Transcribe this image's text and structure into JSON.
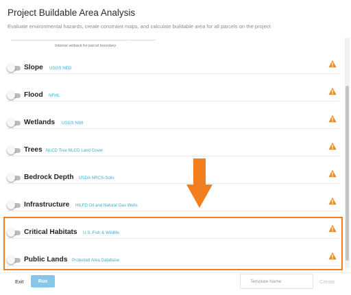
{
  "header": {
    "title": "Project Buildable Area Analysis",
    "subtitle": "Evaluate environmental hazards, create constraint maps, and calculate buildable area for all parcels on the project"
  },
  "setback": {
    "note": "Internal setback for parcel boundary"
  },
  "layers": [
    {
      "label": "Slope",
      "sources": "USGS NED",
      "enabled": false,
      "warning": true
    },
    {
      "label": "Flood",
      "sources": "NFHL",
      "enabled": false,
      "warning": true
    },
    {
      "label": "Wetlands",
      "sources": "USGS NWI",
      "enabled": false,
      "warning": true
    },
    {
      "label": "Trees",
      "sources": "NLCD Tree  NLCD Land Cover",
      "enabled": false,
      "warning": true
    },
    {
      "label": "Bedrock Depth",
      "sources": "USDA NRCS-Soils",
      "enabled": false,
      "warning": true
    },
    {
      "label": "Infrastructure",
      "sources": "HILFD  Oil and Natural Gas Wells",
      "enabled": false,
      "warning": true
    },
    {
      "label": "Critical Habitats",
      "sources": "U.S. Fish & Wildlife",
      "enabled": false,
      "warning": true
    },
    {
      "label": "Public Lands",
      "sources": "Protected Area Database",
      "enabled": false,
      "warning": true
    }
  ],
  "footer": {
    "exit_label": "Exit",
    "run_label": "Run",
    "template_placeholder": "Template Name",
    "create_label": "Create"
  },
  "colors": {
    "accent": "#f27e1e",
    "source_link": "#43a7d9",
    "run_button": "#85c6ea",
    "warning_icon": "#f08a24"
  },
  "icons": {
    "warning": "warning-triangle-icon",
    "annotation_arrow": "down-arrow-icon"
  }
}
